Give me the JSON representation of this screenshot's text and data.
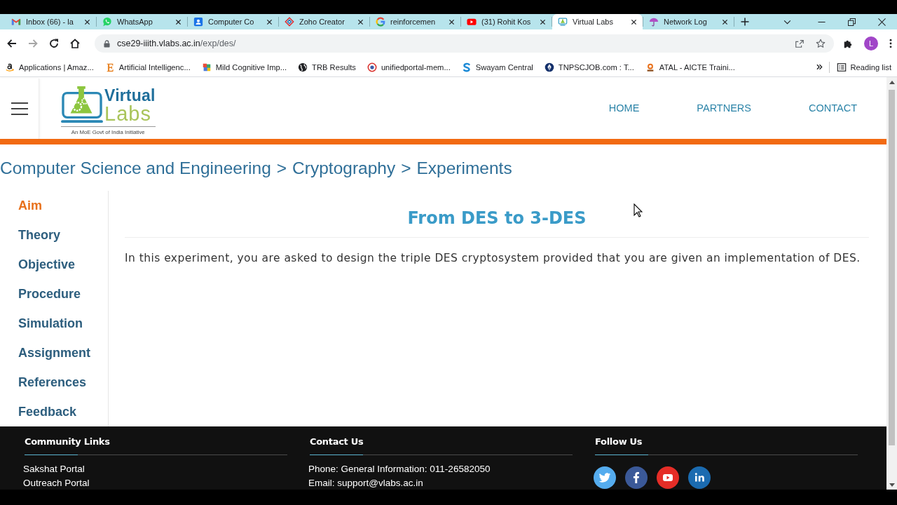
{
  "browser": {
    "tabs": [
      {
        "title": "Inbox (66) - la",
        "selected": false
      },
      {
        "title": "WhatsApp",
        "selected": false
      },
      {
        "title": "Computer Co",
        "selected": false
      },
      {
        "title": "Zoho Creator",
        "selected": false
      },
      {
        "title": "reinforcemen",
        "selected": false
      },
      {
        "title": "(31) Rohit Kos",
        "selected": false
      },
      {
        "title": "Virtual Labs",
        "selected": true
      },
      {
        "title": "Network Log",
        "selected": false
      }
    ],
    "nav_buttons": [
      {
        "disabled": false
      },
      {
        "disabled": true
      },
      {
        "disabled": false
      },
      {
        "disabled": false
      }
    ],
    "address": {
      "host": "cse29-iiith.vlabs.ac.in",
      "path": "/exp/des/"
    },
    "profile_initial": "L",
    "bookmarks": [
      "Applications | Amaz...",
      "Artificial Intelligenc...",
      "Mild Cognitive Imp...",
      "TRB Results",
      "unifiedportal-mem...",
      "Swayam Central",
      "TNPSCJOB.com : T...",
      "ATAL - AICTE Traini..."
    ],
    "reading_list": "Reading list"
  },
  "site": {
    "logo": {
      "top": "Virtual",
      "bottom": "Labs",
      "tagline": "An MoE Govt of India Initiative"
    },
    "nav": [
      "HOME",
      "PARTNERS",
      "CONTACT"
    ],
    "breadcrumb": {
      "items": [
        "Computer Science and Engineering",
        "Cryptography",
        "Experiments"
      ],
      "separator": ">"
    },
    "sidebar": [
      {
        "label": "Aim",
        "selected": true
      },
      {
        "label": "Theory",
        "selected": false
      },
      {
        "label": "Objective",
        "selected": false
      },
      {
        "label": "Procedure",
        "selected": false
      },
      {
        "label": "Simulation",
        "selected": false
      },
      {
        "label": "Assignment",
        "selected": false
      },
      {
        "label": "References",
        "selected": false
      },
      {
        "label": "Feedback",
        "selected": false
      }
    ],
    "experiment": {
      "title": "From DES to 3-DES",
      "text": "In this experiment, you are asked to design the triple DES cryptosystem provided that you are given an implementation of DES."
    },
    "footer": {
      "community_links": {
        "heading": "Community Links",
        "lines": [
          "Sakshat Portal",
          "Outreach Portal"
        ]
      },
      "contact_us": {
        "heading": "Contact Us",
        "lines": [
          "Phone: General Information: 011-26582050",
          "Email: support@vlabs.ac.in"
        ]
      },
      "follow_us": {
        "heading": "Follow Us",
        "social": [
          {
            "color": "#55acee"
          },
          {
            "color": "#3b5998"
          },
          {
            "color": "#e52d27"
          },
          {
            "color": "#1b6bb0"
          }
        ]
      }
    }
  }
}
